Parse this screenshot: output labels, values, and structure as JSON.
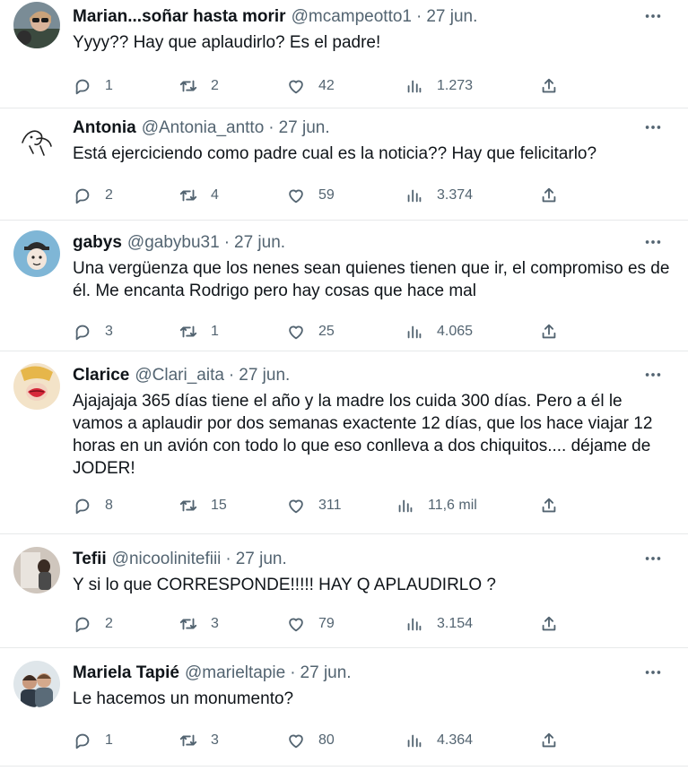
{
  "tweets": [
    {
      "name": "Marian...soñar hasta morir",
      "handle": "@mcampeotto1",
      "date": "27 jun.",
      "text": "Yyyy?? Hay que aplaudirlo? Es el padre!",
      "replies": "1",
      "retweets": "2",
      "likes": "42",
      "views": "1.273",
      "avatar": "woman-with-sunglasses-avatar"
    },
    {
      "name": "Antonia",
      "handle": "@Antonia_antto",
      "date": "27 jun.",
      "text": "Está ejerciciendo como padre cual es la noticia?? Hay que felicitarlo?",
      "replies": "2",
      "retweets": "4",
      "likes": "59",
      "views": "3.374",
      "avatar": "line-sketch-avatar"
    },
    {
      "name": "gabys",
      "handle": "@gabybu31",
      "date": "27 jun.",
      "text": "Una vergüenza que los nenes sean quienes tienen que ir, el compromiso es de él. Me encanta Rodrigo pero hay cosas que hace mal",
      "replies": "3",
      "retweets": "1",
      "likes": "25",
      "views": "4.065",
      "avatar": "cartoon-character-avatar"
    },
    {
      "name": "Clarice",
      "handle": "@Clari_aita",
      "date": "27 jun.",
      "text": "Ajajajaja 365 días tiene el año y la madre los cuida 300 días. Pero a él le vamos a aplaudir por dos semanas exactente 12 días, que los hace viajar 12 horas en un avión con todo lo que eso conlleva a dos chiquitos.... déjame de JODER!",
      "replies": "8",
      "retweets": "15",
      "likes": "311",
      "views": "11,6 mil",
      "avatar": "lips-illustration-avatar"
    },
    {
      "name": "Tefii",
      "handle": "@nicoolinitefiii",
      "date": "27 jun.",
      "text": "Y si lo que CORRESPONDE!!!!! HAY Q APLAUDIRLO ?",
      "replies": "2",
      "retweets": "3",
      "likes": "79",
      "views": "3.154",
      "avatar": "mirror-selfie-avatar"
    },
    {
      "name": "Mariela Tapié",
      "handle": "@marieltapie",
      "date": "27 jun.",
      "text": "Le hacemos un monumento?",
      "replies": "1",
      "retweets": "3",
      "likes": "80",
      "views": "4.364",
      "avatar": "couple-photo-avatar"
    }
  ],
  "colors": {
    "text": "#0f1419",
    "secondary": "#536471",
    "divider": "#e7e9ea"
  }
}
